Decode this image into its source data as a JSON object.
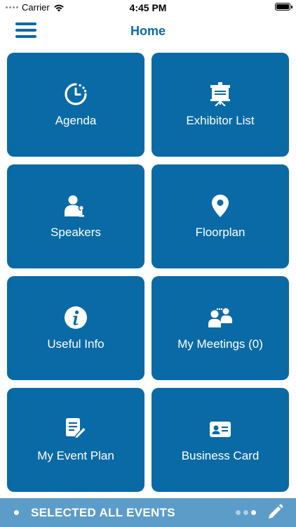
{
  "status": {
    "carrier": "Carrier",
    "time": "4:45 PM",
    "battery_level": 1.0
  },
  "nav": {
    "title": "Home"
  },
  "tiles": [
    {
      "label": "Agenda",
      "icon": "clock-icon"
    },
    {
      "label": "Exhibitor List",
      "icon": "presentation-board-icon"
    },
    {
      "label": "Speakers",
      "icon": "speaker-person-icon"
    },
    {
      "label": "Floorplan",
      "icon": "map-pin-icon"
    },
    {
      "label": "Useful Info",
      "icon": "info-icon"
    },
    {
      "label": "My Meetings (0)",
      "icon": "meeting-people-icon"
    },
    {
      "label": "My Event Plan",
      "icon": "document-edit-icon"
    },
    {
      "label": "Business Card",
      "icon": "id-card-icon"
    }
  ],
  "bottom_bar": {
    "label": "SELECTED ALL EVENTS",
    "page_count": 3,
    "active_page": 3
  },
  "colors": {
    "primary": "#0a6aa5",
    "bottom_bar": "#5b9cc9",
    "text_on_primary": "#ffffff"
  }
}
